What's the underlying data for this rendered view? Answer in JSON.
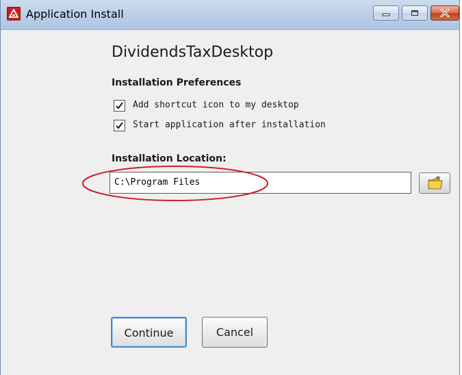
{
  "window": {
    "title": "Application Install",
    "controls": {
      "minimize": "minimize-icon",
      "maximize": "maximize-icon",
      "close": "close-icon"
    }
  },
  "app_name": "DividendsTaxDesktop",
  "preferences": {
    "heading": "Installation Preferences",
    "options": [
      {
        "label": "Add shortcut icon to my desktop",
        "checked": true
      },
      {
        "label": "Start application after installation",
        "checked": true
      }
    ]
  },
  "location": {
    "heading": "Installation Location:",
    "value": "C:\\Program Files",
    "browse_icon": "folder-icon"
  },
  "buttons": {
    "continue": "Continue",
    "cancel": "Cancel"
  },
  "colors": {
    "title_bar": "#bcd0e8",
    "app_icon": "#d21a1a",
    "close_button": "#c4401f",
    "highlight_ellipse": "#c8202a",
    "default_button_border": "#4a88c7"
  }
}
